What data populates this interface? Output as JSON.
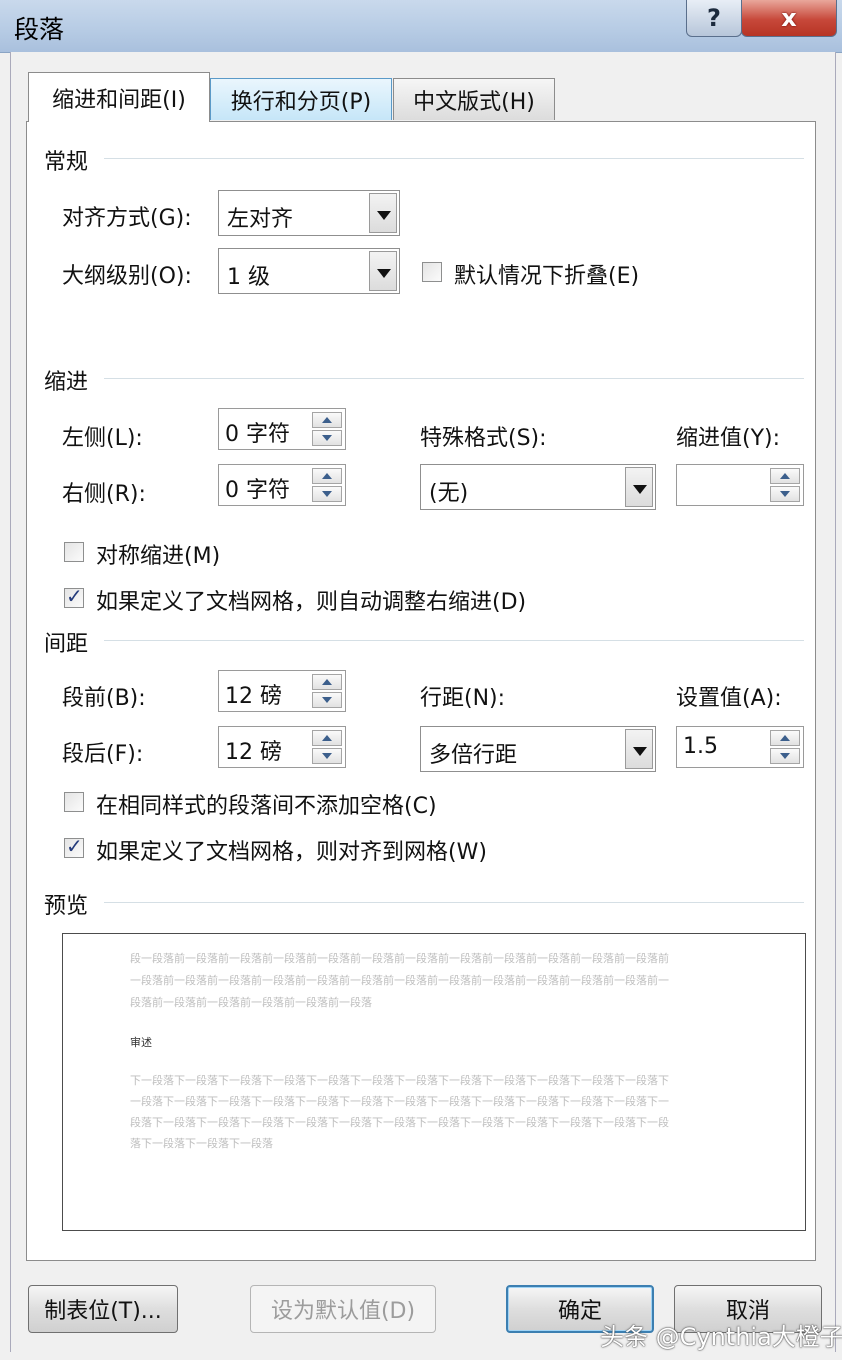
{
  "window": {
    "title": "段落",
    "help_glyph": "?",
    "close_glyph": "x"
  },
  "tabs": [
    {
      "label": "缩进和间距(I)"
    },
    {
      "label": "换行和分页(P)"
    },
    {
      "label": "中文版式(H)"
    }
  ],
  "general": {
    "heading": "常规",
    "alignment_label": "对齐方式(G):",
    "alignment_value": "左对齐",
    "outline_label": "大纲级别(O):",
    "outline_value": "1 级",
    "collapse_label": "默认情况下折叠(E)",
    "collapse_checked": false
  },
  "indent": {
    "heading": "缩进",
    "left_label": "左侧(L):",
    "left_value": "0 字符",
    "right_label": "右侧(R):",
    "right_value": "0 字符",
    "special_label": "特殊格式(S):",
    "special_value": "(无)",
    "by_label": "缩进值(Y):",
    "by_value": "",
    "mirror_label": "对称缩进(M)",
    "mirror_checked": false,
    "grid_label": "如果定义了文档网格，则自动调整右缩进(D)",
    "grid_checked": true
  },
  "spacing": {
    "heading": "间距",
    "before_label": "段前(B):",
    "before_value": "12 磅",
    "after_label": "段后(F):",
    "after_value": "12 磅",
    "line_label": "行距(N):",
    "line_value": "多倍行距",
    "at_label": "设置值(A):",
    "at_value": "1.5",
    "nospace_label": "在相同样式的段落间不添加空格(C)",
    "nospace_checked": false,
    "snap_label": "如果定义了文档网格，则对齐到网格(W)",
    "snap_checked": true
  },
  "preview": {
    "heading": "预览",
    "prev_lines": [
      "段一段落前一段落前一段落前一段落前一段落前一段落前一段落前一段落前一段落前一段落前一段落前一段落前",
      "一段落前一段落前一段落前一段落前一段落前一段落前一段落前一段落前一段落前一段落前一段落前一段落前一",
      "段落前一段落前一段落前一段落前一段落前一段落"
    ],
    "sample": "审述",
    "next_lines": [
      "下一段落下一段落下一段落下一段落下一段落下一段落下一段落下一段落下一段落下一段落下一段落下一段落下",
      "一段落下一段落下一段落下一段落下一段落下一段落下一段落下一段落下一段落下一段落下一段落下一段落下一",
      "段落下一段落下一段落下一段落下一段落下一段落下一段落下一段落下一段落下一段落下一段落下一段落下一段",
      "落下一段落下一段落下一段落"
    ]
  },
  "buttons": {
    "tabs": "制表位(T)...",
    "set_default": "设为默认值(D)",
    "ok": "确定",
    "cancel": "取消"
  },
  "watermark": "头条 @Cynthia大橙子"
}
